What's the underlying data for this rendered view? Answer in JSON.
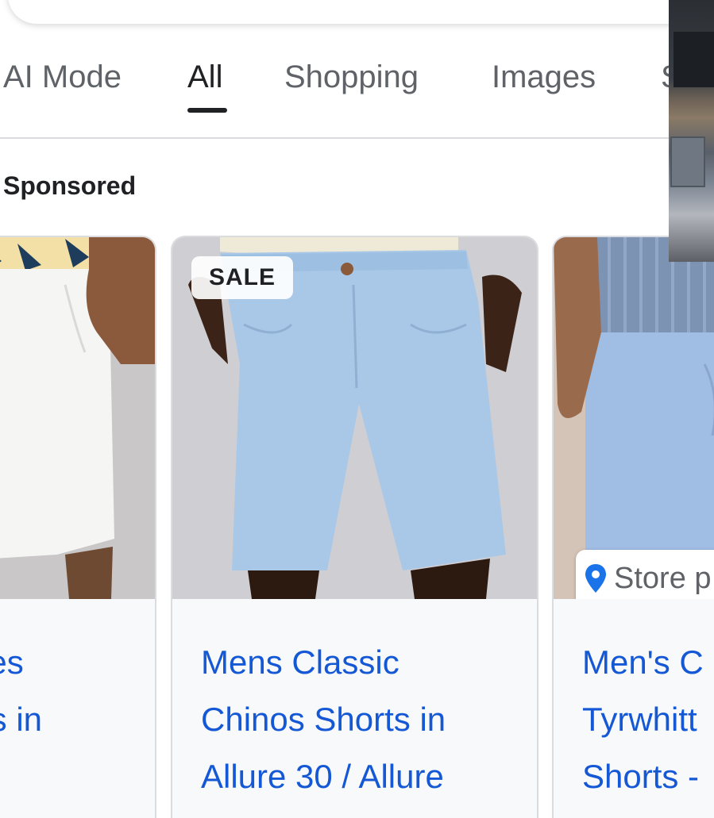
{
  "tabs": [
    {
      "label": "AI Mode",
      "active": false
    },
    {
      "label": "All",
      "active": true
    },
    {
      "label": "Shopping",
      "active": false
    },
    {
      "label": "Images",
      "active": false
    },
    {
      "label": "S",
      "active": false
    }
  ],
  "section": {
    "label": "Sponsored"
  },
  "products": [
    {
      "title_lines": [
        "nes",
        "rts in"
      ],
      "badge": "",
      "store_tag": ""
    },
    {
      "title_lines": [
        "Mens Classic",
        "Chinos Shorts in",
        "Allure 30 / Allure"
      ],
      "badge": "SALE",
      "store_tag": ""
    },
    {
      "title_lines": [
        "Men's C",
        "Tyrwhitt",
        "Shorts -"
      ],
      "badge": "",
      "store_tag": "Store p"
    }
  ],
  "colors": {
    "link": "#1558d6",
    "tab_active": "#202124",
    "tab_inactive": "#5f6368",
    "card_border": "#dadce0",
    "shorts_blue": "#a9c8e8",
    "pin": "#1a73e8"
  },
  "icons": {
    "store_pin": "map-pin-icon"
  }
}
